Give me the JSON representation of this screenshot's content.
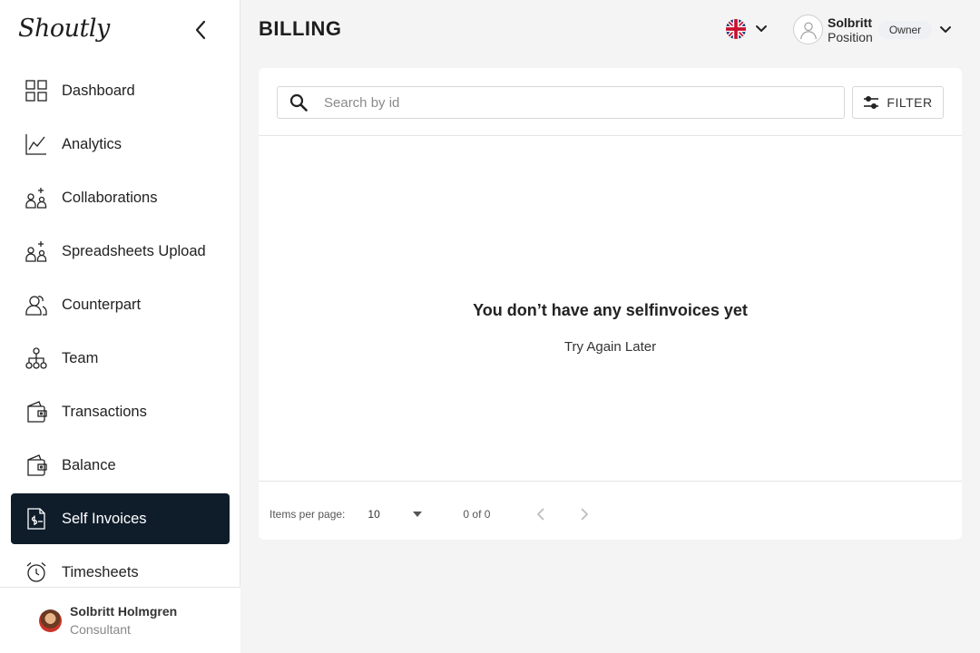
{
  "app": {
    "logo_text": "Shoutly"
  },
  "sidebar": {
    "items": [
      {
        "label": "Dashboard",
        "icon": "dashboard-icon"
      },
      {
        "label": "Analytics",
        "icon": "analytics-icon"
      },
      {
        "label": "Collaborations",
        "icon": "collaborations-icon"
      },
      {
        "label": "Spreadsheets Upload",
        "icon": "spreadsheets-upload-icon"
      },
      {
        "label": "Counterpart",
        "icon": "counterpart-icon"
      },
      {
        "label": "Team",
        "icon": "team-icon"
      },
      {
        "label": "Transactions",
        "icon": "transactions-icon"
      },
      {
        "label": "Balance",
        "icon": "balance-icon"
      },
      {
        "label": "Self Invoices",
        "icon": "self-invoices-icon",
        "active": true
      },
      {
        "label": "Timesheets",
        "icon": "timesheets-icon"
      }
    ],
    "footer": {
      "name": "Solbritt Holmgren",
      "role": "Consultant"
    }
  },
  "header": {
    "title": "BILLING",
    "language": "en-GB",
    "user": {
      "name": "Solbritt",
      "position": "Position",
      "role_badge": "Owner"
    }
  },
  "search": {
    "placeholder": "Search by id",
    "value": ""
  },
  "filter": {
    "label": "FILTER"
  },
  "empty_state": {
    "title": "You don’t have any selfinvoices yet",
    "subtitle": "Try Again Later"
  },
  "pagination": {
    "items_per_page_label": "Items per page:",
    "items_per_page": "10",
    "range": "0 of 0"
  },
  "colors": {
    "active_bg": "#0f1d2b",
    "background": "#f4f4f4"
  }
}
